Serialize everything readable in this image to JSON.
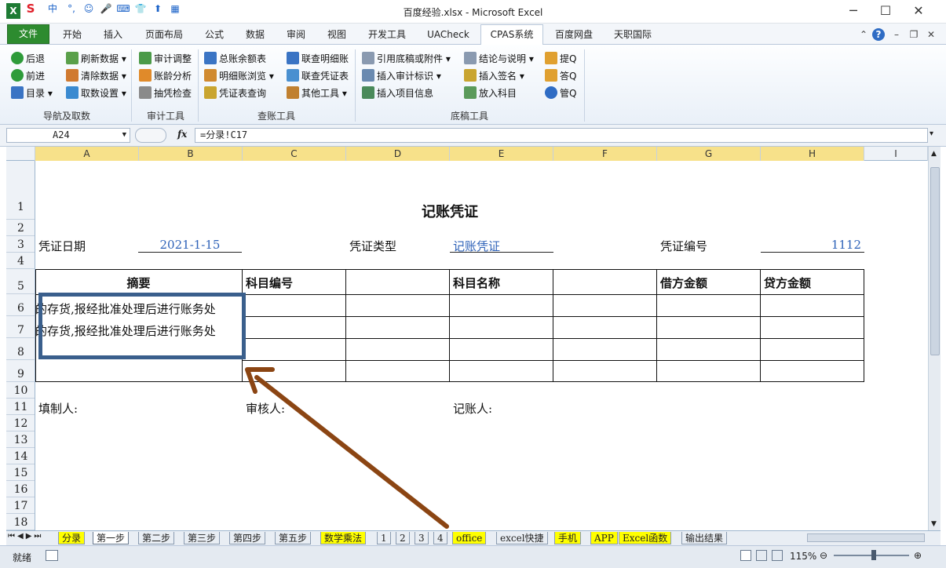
{
  "window": {
    "title": "百度经验.xlsx - Microsoft Excel",
    "minimize": "─",
    "maximize": "☐",
    "close": "✕"
  },
  "ribbon_tabs": [
    "文件",
    "开始",
    "插入",
    "页面布局",
    "公式",
    "数据",
    "审阅",
    "视图",
    "开发工具",
    "UACheck",
    "CPAS系统",
    "百度网盘",
    "天职国际"
  ],
  "ribbon": {
    "groups": {
      "nav": {
        "label": "导航及取数",
        "items": [
          "后退",
          "前进",
          "目录",
          "刷新数据",
          "清除数据",
          "取数设置"
        ]
      },
      "audit": {
        "label": "审计工具",
        "items": [
          "审计调整",
          "账龄分析",
          "抽凭检查"
        ]
      },
      "query": {
        "label": "查账工具",
        "items": [
          "总账余额表",
          "明细账浏览",
          "凭证表查询",
          "联查明细账",
          "联查凭证表",
          "其他工具"
        ]
      },
      "draft": {
        "label": "底稿工具",
        "items": [
          "引用底稿或附件",
          "插入审计标识",
          "插入项目信息",
          "结论与说明",
          "插入签名",
          "放入科目",
          "提Q",
          "答Q",
          "管Q"
        ]
      }
    }
  },
  "formula_bar": {
    "name_box": "A24",
    "fx": "fx",
    "formula": "=分录!C17"
  },
  "columns": [
    "A",
    "B",
    "C",
    "D",
    "E",
    "F",
    "G",
    "H",
    "I"
  ],
  "rows": [
    "1",
    "2",
    "3",
    "4",
    "5",
    "6",
    "7",
    "8",
    "9",
    "10",
    "11",
    "12",
    "13",
    "14",
    "15",
    "16",
    "17",
    "18"
  ],
  "sheet": {
    "title": "记账凭证",
    "date_label": "凭证日期",
    "date_value": "2021-1-15",
    "type_label": "凭证类型",
    "type_value": "记账凭证",
    "number_label": "凭证编号",
    "number_value": "1112",
    "headers": {
      "summary": "摘要",
      "account_code": "科目编号",
      "account_name": "科目名称",
      "debit": "借方金额",
      "credit": "贷方金额"
    },
    "row6_summary": "的存货,报经批准处理后进行账务处",
    "row7_summary": "的存货,报经批准处理后进行账务处",
    "preparer": "填制人:",
    "reviewer": "审核人:",
    "bookkeeper": "记账人:"
  },
  "sheet_tabs": [
    "分录",
    "第一步",
    "第二步",
    "第三步",
    "第四步",
    "第五步",
    "数学乘法",
    "1",
    "2",
    "3",
    "4",
    "office",
    "excel快捷",
    "手机",
    "APP",
    "Excel函数",
    "输出结果"
  ],
  "active_sheet_tab": "第一步",
  "status": {
    "ready": "就绪",
    "zoom": "115%"
  },
  "colors": {
    "annotation_box": "#3a5f8c",
    "arrow": "#8b4513",
    "sheet_tab_yellow": "#ffff00",
    "file_tab": "#2d8b2f"
  }
}
